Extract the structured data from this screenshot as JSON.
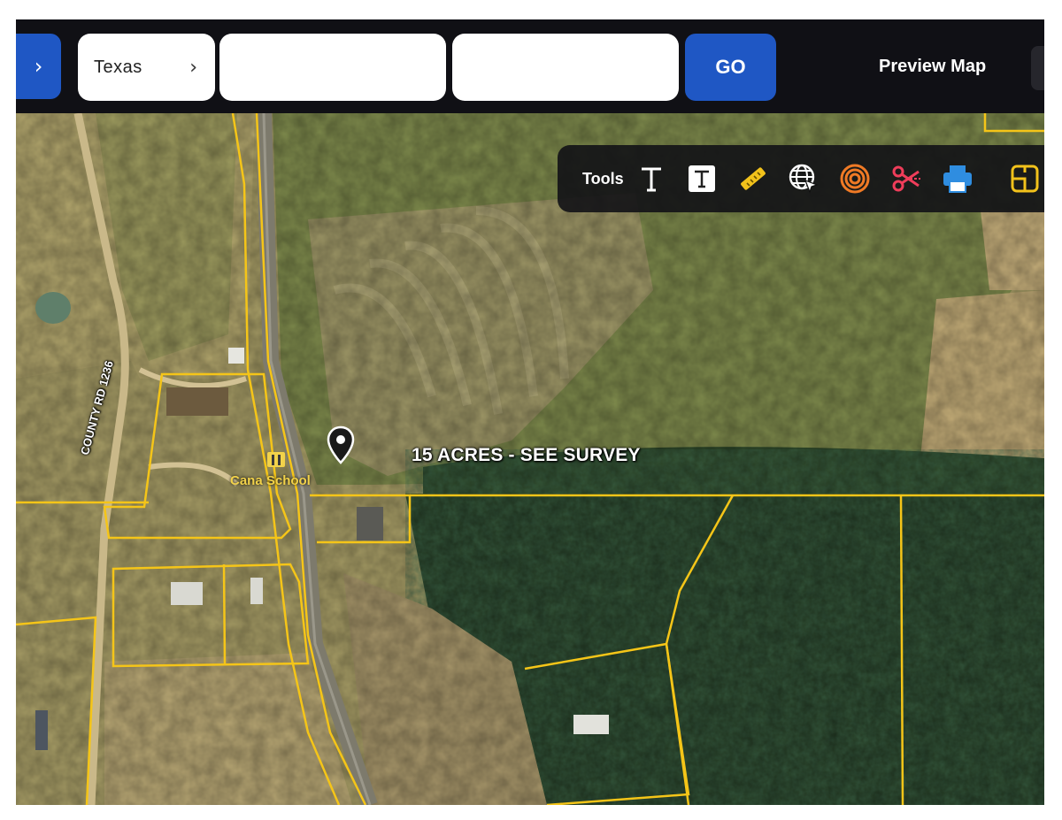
{
  "toolbar": {
    "nav_arrow": "›",
    "state_value": "Texas",
    "state_chevron": "›",
    "field2_value": "",
    "field3_value": "",
    "go_label": "GO",
    "preview_label": "Preview Map"
  },
  "tools_panel": {
    "label": "Tools",
    "icons": [
      "text-icon",
      "text-box-icon",
      "ruler-icon",
      "globe-cursor-icon",
      "radius-rings-icon",
      "scissors-icon",
      "print-icon",
      "layers-icon"
    ]
  },
  "map": {
    "parcel_label": "15 ACRES - SEE SURVEY",
    "poi_label": "Cana School",
    "road_label": "COUNTY RD 1236"
  },
  "colors": {
    "accent_blue": "#1f57c4",
    "parcel_line": "#f5c518",
    "toolbar_bg": "#101015"
  }
}
